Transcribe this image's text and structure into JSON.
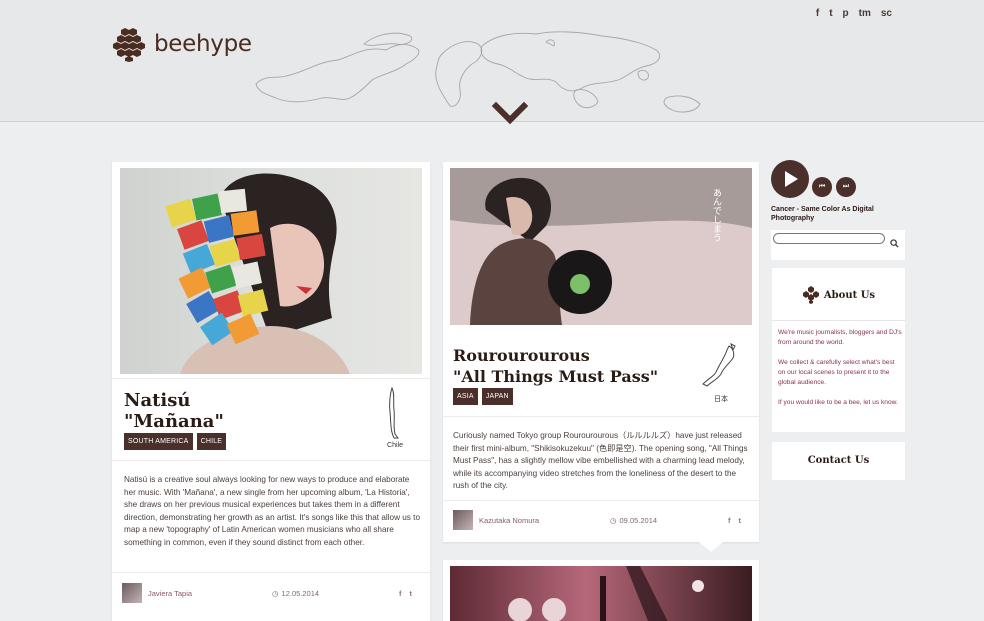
{
  "brand": {
    "name": "beehype"
  },
  "social": [
    "f",
    "t",
    "p",
    "tm",
    "sc"
  ],
  "posts": [
    {
      "title_line1": "Natisú",
      "title_line2": "\"Mañana\"",
      "tags": [
        "South America",
        "Chile"
      ],
      "country": "Chile",
      "excerpt": "Natisú is a creative soul always looking for new ways to produce and elaborate her music. With 'Mañana', a new single from her upcoming album, 'La Historia', she draws on her previous musical experiences but takes them in a different direction, demonstrating her growth as an artist. It's songs like this that allow us to map a new 'topography' of Latin American women musicians who all share something in common, even if they sound distinct from each other.",
      "author": "Javiera Tapia",
      "date": "12.05.2014",
      "share": [
        "f",
        "t"
      ]
    },
    {
      "title_line1": "Rourourourous",
      "title_line2": "\"All Things Must Pass\"",
      "tags": [
        "Asia",
        "Japan"
      ],
      "country": "日本",
      "excerpt": "Curiously named Tokyo group Rourourourous（ルルルルズ）have just released their first mini-album, \"Shikisokuzekuu\" (色即是空). The opening song, \"All Things Must Pass\", has a slightly mellow vibe embellished with a charming lead melody, while its accompanying video stretches from the loneliness of the desert to the rush of the city.",
      "author": "Kazutaka Nomura",
      "date": "09.05.2014",
      "share": [
        "f",
        "t"
      ]
    }
  ],
  "player": {
    "track": "Cancer - Same Color As Digital Photography",
    "prev": "⏮",
    "next": "⏭"
  },
  "about": {
    "heading": "About Us",
    "lines": [
      "We're music journalists, bloggers and DJ's from around the world.",
      "We collect & carefully select what's best on our local scenes to present it to the global audience.",
      "If you would like to be a bee, let us know."
    ]
  },
  "contact": {
    "label": "Contact Us"
  }
}
